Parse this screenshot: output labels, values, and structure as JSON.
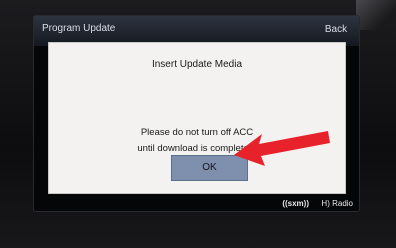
{
  "header": {
    "title": "Program Update",
    "back_label": "Back"
  },
  "dialog": {
    "title": "Insert Update Media",
    "message_line1": "Please do not turn off ACC",
    "message_line2": "until download is completed.",
    "ok_label": "OK"
  },
  "branding": {
    "sxm": "((sxm))",
    "hd_radio": "H) Radio"
  },
  "colors": {
    "ok_button": "#7f8fae",
    "arrow": "#e8222a",
    "dialog_bg": "#f3f2f0"
  }
}
